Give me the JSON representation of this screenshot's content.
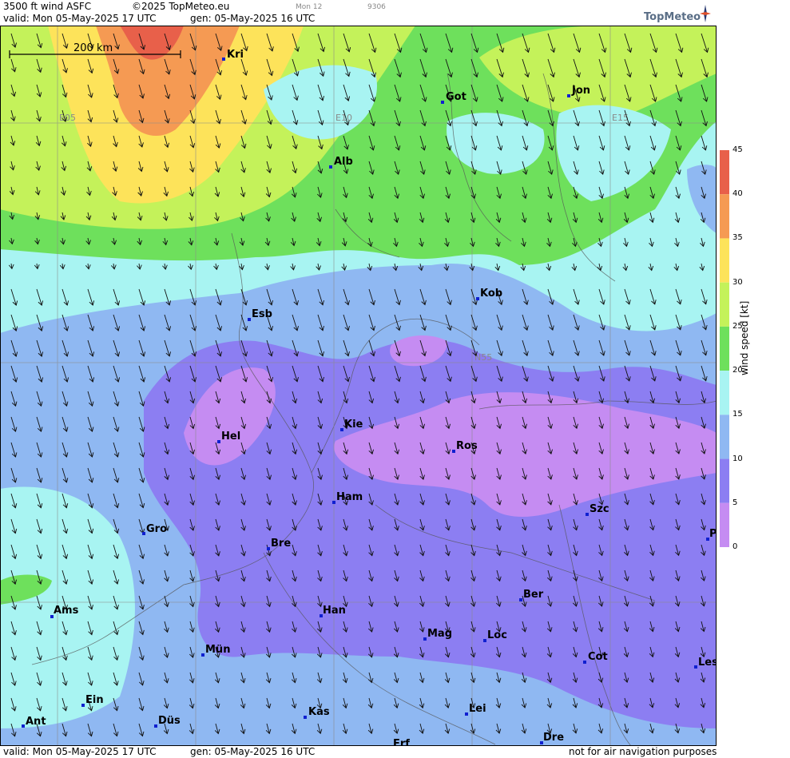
{
  "header": {
    "product": "3500 ft wind ASFC",
    "copyright": "©2025 TopMeteo.eu",
    "model_small": "Mon 12",
    "code_small": "9306",
    "valid": "valid:  Mon  05-May-2025  17 UTC",
    "gen": "gen: 05-May-2025 16 UTC",
    "logo": "TopMeteo"
  },
  "footer": {
    "valid": "valid:  Mon  05-May-2025  17 UTC",
    "gen": "gen: 05-May-2025 16 UTC",
    "disclaimer": "not for air navigation purposes"
  },
  "scale_bar": {
    "label": "200 km"
  },
  "grid_labels": {
    "e05": "E05",
    "e10": "E10",
    "e15": "E15",
    "n55": "N55"
  },
  "cities": {
    "kri": "Kri",
    "got": "Got",
    "jon": "Jon",
    "alb": "Alb",
    "kob": "Kob",
    "esb": "Esb",
    "kie": "Kie",
    "hel": "Hel",
    "ros": "Ros",
    "ham": "Ham",
    "szc": "Szc",
    "p": "P",
    "gro": "Gro",
    "bre": "Bre",
    "ber": "Ber",
    "ams": "Ams",
    "han": "Han",
    "mag": "Mag",
    "loc": "Loc",
    "mun": "Mün",
    "cot": "Cot",
    "les": "Les",
    "ein": "Ein",
    "kas": "Kas",
    "lei": "Lei",
    "ant": "Ant",
    "dus": "Düs",
    "dre": "Dre",
    "erf": "Erf"
  },
  "legend": {
    "title": "wind speed [kt]",
    "ticks": [
      "45",
      "40",
      "35",
      "30",
      "25",
      "20",
      "15",
      "10",
      "5",
      "0"
    ],
    "bands": [
      {
        "from": 40,
        "to": 45,
        "color": "#e8604a"
      },
      {
        "from": 35,
        "to": 40,
        "color": "#f59a53"
      },
      {
        "from": 30,
        "to": 35,
        "color": "#fde35a"
      },
      {
        "from": 25,
        "to": 30,
        "color": "#c4f25a"
      },
      {
        "from": 20,
        "to": 25,
        "color": "#6ee05c"
      },
      {
        "from": 15,
        "to": 20,
        "color": "#a8f4f2"
      },
      {
        "from": 10,
        "to": 15,
        "color": "#8fb8f2"
      },
      {
        "from": 5,
        "to": 10,
        "color": "#8c7ef2"
      },
      {
        "from": 0,
        "to": 5,
        "color": "#c58cf2"
      }
    ]
  }
}
